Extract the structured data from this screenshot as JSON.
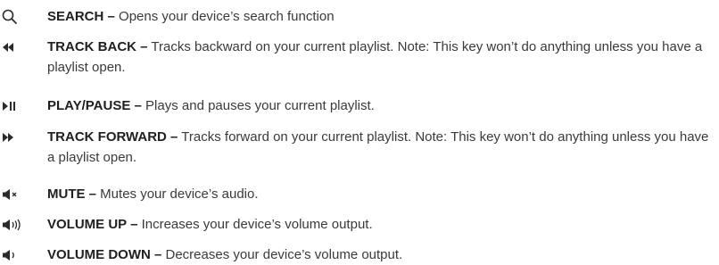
{
  "keys": [
    {
      "icon": "search-icon",
      "name": "SEARCH –",
      "description": " Opens your device’s search function"
    },
    {
      "icon": "track-back-icon",
      "name": "TRACK BACK –",
      "description": " Tracks backward on your current playlist. Note: This key won’t do anything unless you have a playlist open."
    },
    {
      "icon": "play-pause-icon",
      "name": "PLAY/PAUSE –",
      "description": " Plays and pauses your current playlist."
    },
    {
      "icon": "track-forward-icon",
      "name": "TRACK FORWARD –",
      "description": " Tracks forward on your current playlist. Note: This key won’t do anything unless you have a playlist open."
    },
    {
      "icon": "mute-icon",
      "name": "MUTE –",
      "description": " Mutes your device’s audio."
    },
    {
      "icon": "volume-up-icon",
      "name": "VOLUME UP –",
      "description": " Increases your device’s volume output."
    },
    {
      "icon": "volume-down-icon",
      "name": "VOLUME DOWN –",
      "description": " Decreases your device’s volume output."
    }
  ]
}
